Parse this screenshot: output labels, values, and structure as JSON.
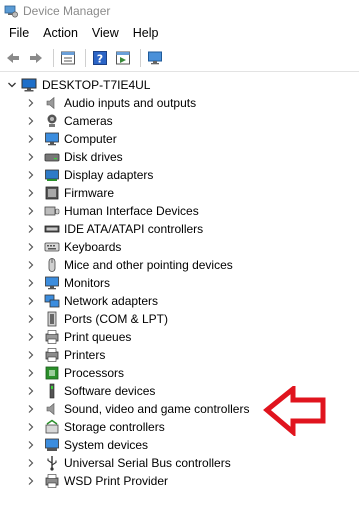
{
  "window": {
    "title": "Device Manager",
    "icon": "device-manager-icon"
  },
  "menu": [
    "File",
    "Action",
    "View",
    "Help"
  ],
  "toolbar": {
    "buttons": [
      "back-arrow-icon",
      "forward-arrow-icon",
      "properties-icon",
      "help-icon",
      "device-view-icon",
      "scan-hardware-icon"
    ]
  },
  "tree": {
    "root": {
      "label": "DESKTOP-T7IE4UL",
      "expanded": true,
      "icon": "computer-icon"
    },
    "categories": [
      {
        "label": "Audio inputs and outputs",
        "icon": "speaker-icon"
      },
      {
        "label": "Cameras",
        "icon": "camera-icon"
      },
      {
        "label": "Computer",
        "icon": "monitor-icon"
      },
      {
        "label": "Disk drives",
        "icon": "disk-drive-icon"
      },
      {
        "label": "Display adapters",
        "icon": "display-adapter-icon"
      },
      {
        "label": "Firmware",
        "icon": "firmware-icon"
      },
      {
        "label": "Human Interface Devices",
        "icon": "hid-icon"
      },
      {
        "label": "IDE ATA/ATAPI controllers",
        "icon": "ide-controller-icon"
      },
      {
        "label": "Keyboards",
        "icon": "keyboard-icon"
      },
      {
        "label": "Mice and other pointing devices",
        "icon": "mouse-icon"
      },
      {
        "label": "Monitors",
        "icon": "monitor-icon"
      },
      {
        "label": "Network adapters",
        "icon": "network-adapter-icon"
      },
      {
        "label": "Ports (COM & LPT)",
        "icon": "port-icon"
      },
      {
        "label": "Print queues",
        "icon": "print-queue-icon"
      },
      {
        "label": "Printers",
        "icon": "printer-icon"
      },
      {
        "label": "Processors",
        "icon": "processor-icon"
      },
      {
        "label": "Software devices",
        "icon": "software-device-icon"
      },
      {
        "label": "Sound, video and game controllers",
        "icon": "speaker-icon"
      },
      {
        "label": "Storage controllers",
        "icon": "storage-controller-icon"
      },
      {
        "label": "System devices",
        "icon": "system-device-icon"
      },
      {
        "label": "Universal Serial Bus controllers",
        "icon": "usb-icon"
      },
      {
        "label": "WSD Print Provider",
        "icon": "wsd-printer-icon"
      }
    ]
  },
  "annotation": {
    "arrow_color": "#e0141e",
    "points_to": "Sound, video and game controllers"
  }
}
